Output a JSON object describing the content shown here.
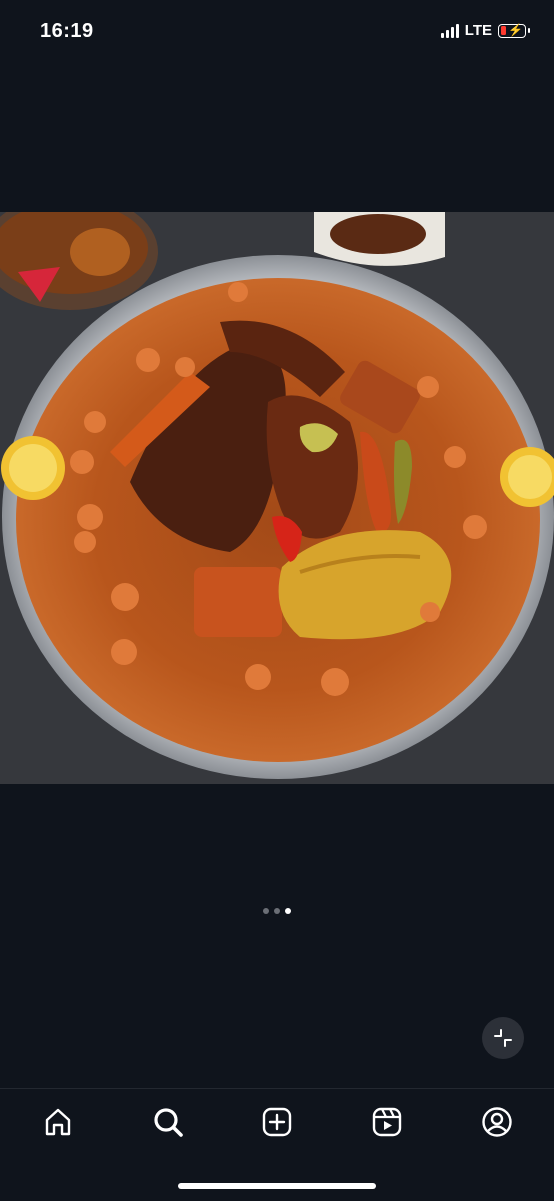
{
  "status_bar": {
    "time": "16:19",
    "network": "LTE",
    "battery_level": 0.15,
    "battery_color": "#ff3b30"
  },
  "post": {
    "image_icon": "food-photo",
    "carousel": {
      "total": 3,
      "active_index": 2
    },
    "collapse_icon": "collapse-icon"
  },
  "tab_bar": {
    "items": [
      {
        "icon": "home-icon"
      },
      {
        "icon": "search-icon"
      },
      {
        "icon": "create-post-icon"
      },
      {
        "icon": "reels-icon"
      },
      {
        "icon": "profile-icon"
      }
    ]
  }
}
